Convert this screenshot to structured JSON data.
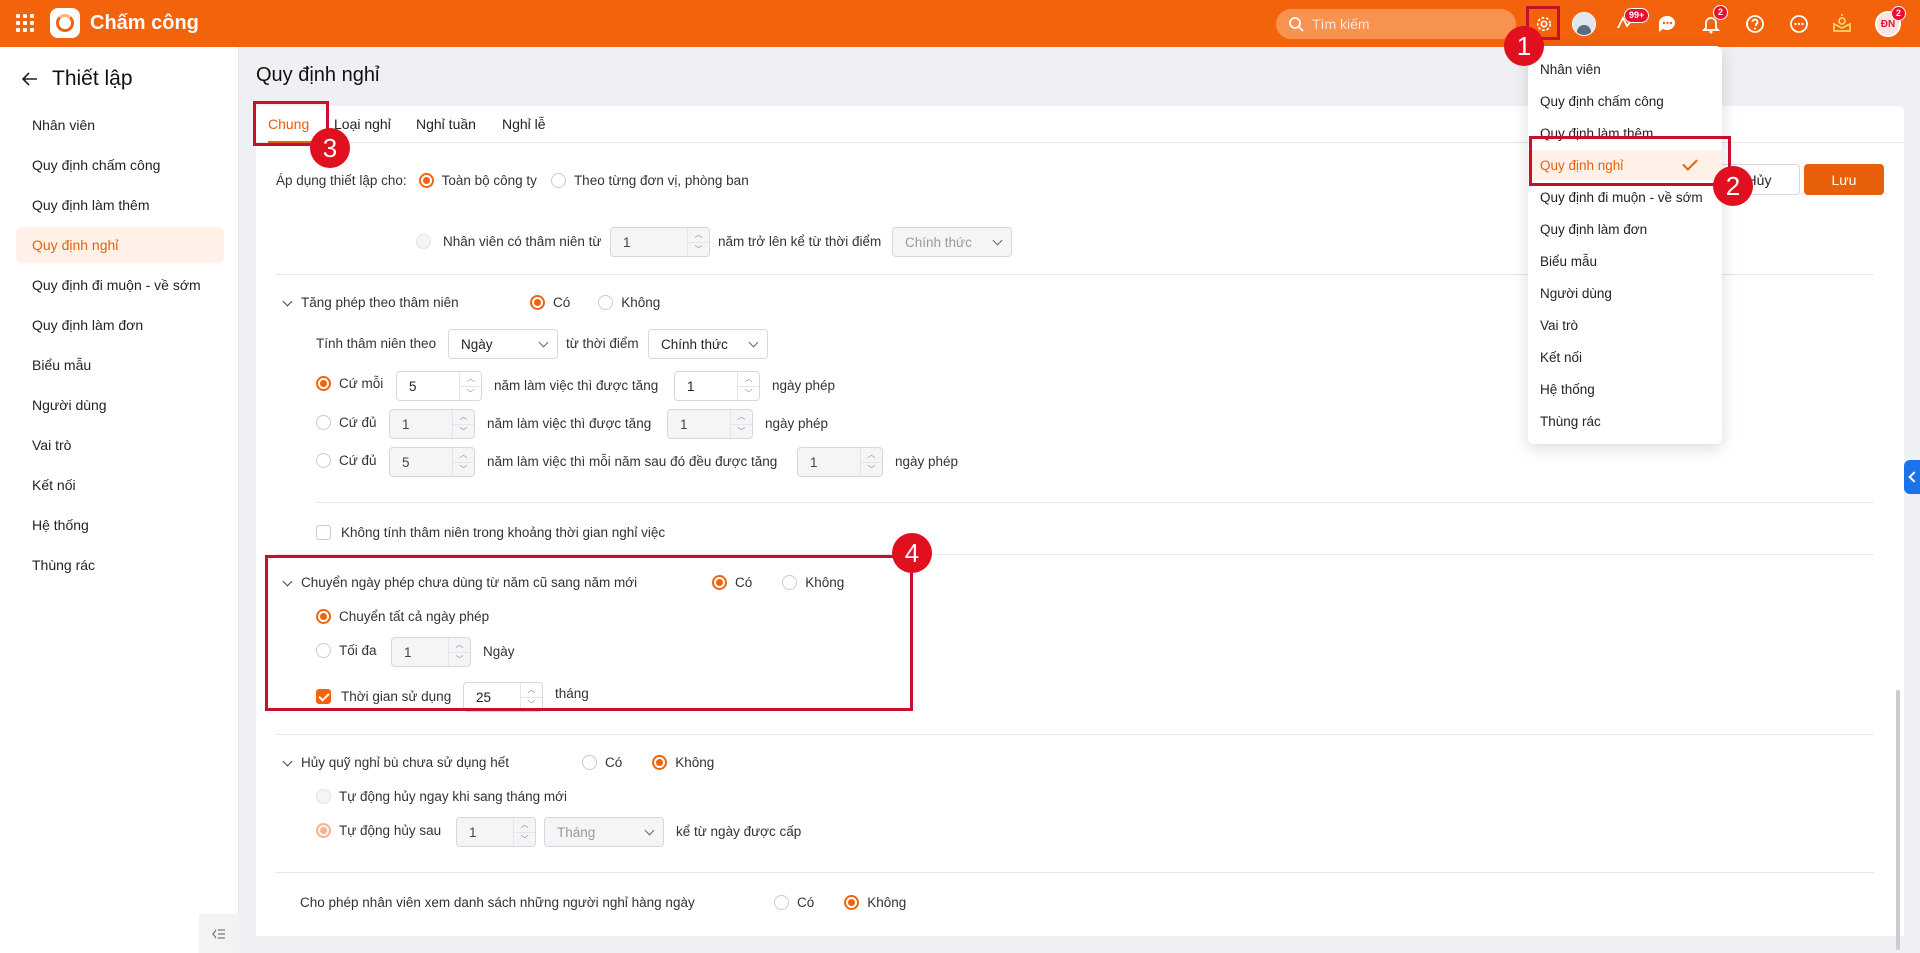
{
  "topbar": {
    "app_title": "Chấm công",
    "search_placeholder": "Tìm kiếm",
    "badges": {
      "approvals": "99+",
      "notifications": "2",
      "profile": "2"
    },
    "avatar_initials": "ĐN"
  },
  "sidebar": {
    "title": "Thiết lập",
    "items": [
      {
        "label": "Nhân viên"
      },
      {
        "label": "Quy định chấm công"
      },
      {
        "label": "Quy định làm thêm"
      },
      {
        "label": "Quy định nghỉ"
      },
      {
        "label": "Quy định đi muộn - về sớm"
      },
      {
        "label": "Quy định làm đơn"
      },
      {
        "label": "Biểu mẫu"
      },
      {
        "label": "Người dùng"
      },
      {
        "label": "Vai trò"
      },
      {
        "label": "Kết nối"
      },
      {
        "label": "Hệ thống"
      },
      {
        "label": "Thùng rác"
      }
    ],
    "active_index": 3
  },
  "page": {
    "title": "Quy định nghỉ",
    "tabs": [
      {
        "label": "Chung"
      },
      {
        "label": "Loại nghỉ"
      },
      {
        "label": "Nghỉ tuần"
      },
      {
        "label": "Nghỉ lễ"
      }
    ],
    "active_tab": 0
  },
  "buttons": {
    "cancel": "Hủy",
    "save": "Lưu"
  },
  "apply": {
    "label": "Áp dụng thiết lập cho:",
    "opt_company": "Toàn bộ công ty",
    "opt_units": "Theo từng đơn vị, phòng ban"
  },
  "seniority_row": {
    "label": "Nhân viên có thâm niên từ",
    "value": "1",
    "suffix": "năm trở lên kể từ thời điểm",
    "select": "Chính thức"
  },
  "section_seniority": {
    "title": "Tăng phép theo thâm niên",
    "yes": "Có",
    "no": "Không",
    "calc_label": "Tính thâm niên theo",
    "calc_unit": "Ngày",
    "from_label": "từ thời điểm",
    "from_value": "Chính thức",
    "opt1": {
      "label": "Cứ mỗi",
      "years": "5",
      "mid": "năm làm việc thì được tăng",
      "days": "1",
      "suffix": "ngày phép"
    },
    "opt2": {
      "label": "Cứ đủ",
      "years": "1",
      "mid": "năm làm việc thì được tăng",
      "days": "1",
      "suffix": "ngày phép"
    },
    "opt3": {
      "label": "Cứ đủ",
      "years": "5",
      "mid": "năm làm việc thì mỗi năm sau đó đều được tăng",
      "days": "1",
      "suffix": "ngày phép"
    },
    "exclude_label": "Không tính thâm niên trong khoảng thời gian nghỉ việc"
  },
  "section_carry": {
    "title": "Chuyển ngày phép chưa dùng từ năm cũ sang năm mới",
    "yes": "Có",
    "no": "Không",
    "opt_all": "Chuyển tất cả ngày phép",
    "opt_max": "Tối đa",
    "max_value": "1",
    "max_unit": "Ngày",
    "use_time_label": "Thời gian sử dụng",
    "use_time_value": "25",
    "use_time_unit": "tháng"
  },
  "section_cancel": {
    "title": "Hủy quỹ nghỉ bù chưa sử dụng hết",
    "yes": "Có",
    "no": "Không",
    "opt_auto_month": "Tự động hủy ngay khi sang tháng mới",
    "opt_after": "Tự động hủy sau",
    "after_value": "1",
    "after_unit": "Tháng",
    "after_suffix": "kể từ ngày được cấp"
  },
  "section_view": {
    "title": "Cho phép nhân viên xem danh sách những người nghỉ hàng ngày",
    "yes": "Có",
    "no": "Không"
  },
  "dropdown": {
    "items": [
      {
        "label": "Nhân viên"
      },
      {
        "label": "Quy định chấm công"
      },
      {
        "label": "Quy định làm thêm"
      },
      {
        "label": "Quy định nghỉ"
      },
      {
        "label": "Quy định đi muộn - về sớm"
      },
      {
        "label": "Quy định làm đơn"
      },
      {
        "label": "Biểu mẫu"
      },
      {
        "label": "Người dùng"
      },
      {
        "label": "Vai trò"
      },
      {
        "label": "Kết nối"
      },
      {
        "label": "Hệ thống"
      },
      {
        "label": "Thùng rác"
      }
    ],
    "active_index": 3
  },
  "annotations": [
    "1",
    "2",
    "3",
    "4"
  ],
  "colors": {
    "brand": "#f2630c",
    "accent": "#e8600c",
    "marker": "#e0101e"
  }
}
